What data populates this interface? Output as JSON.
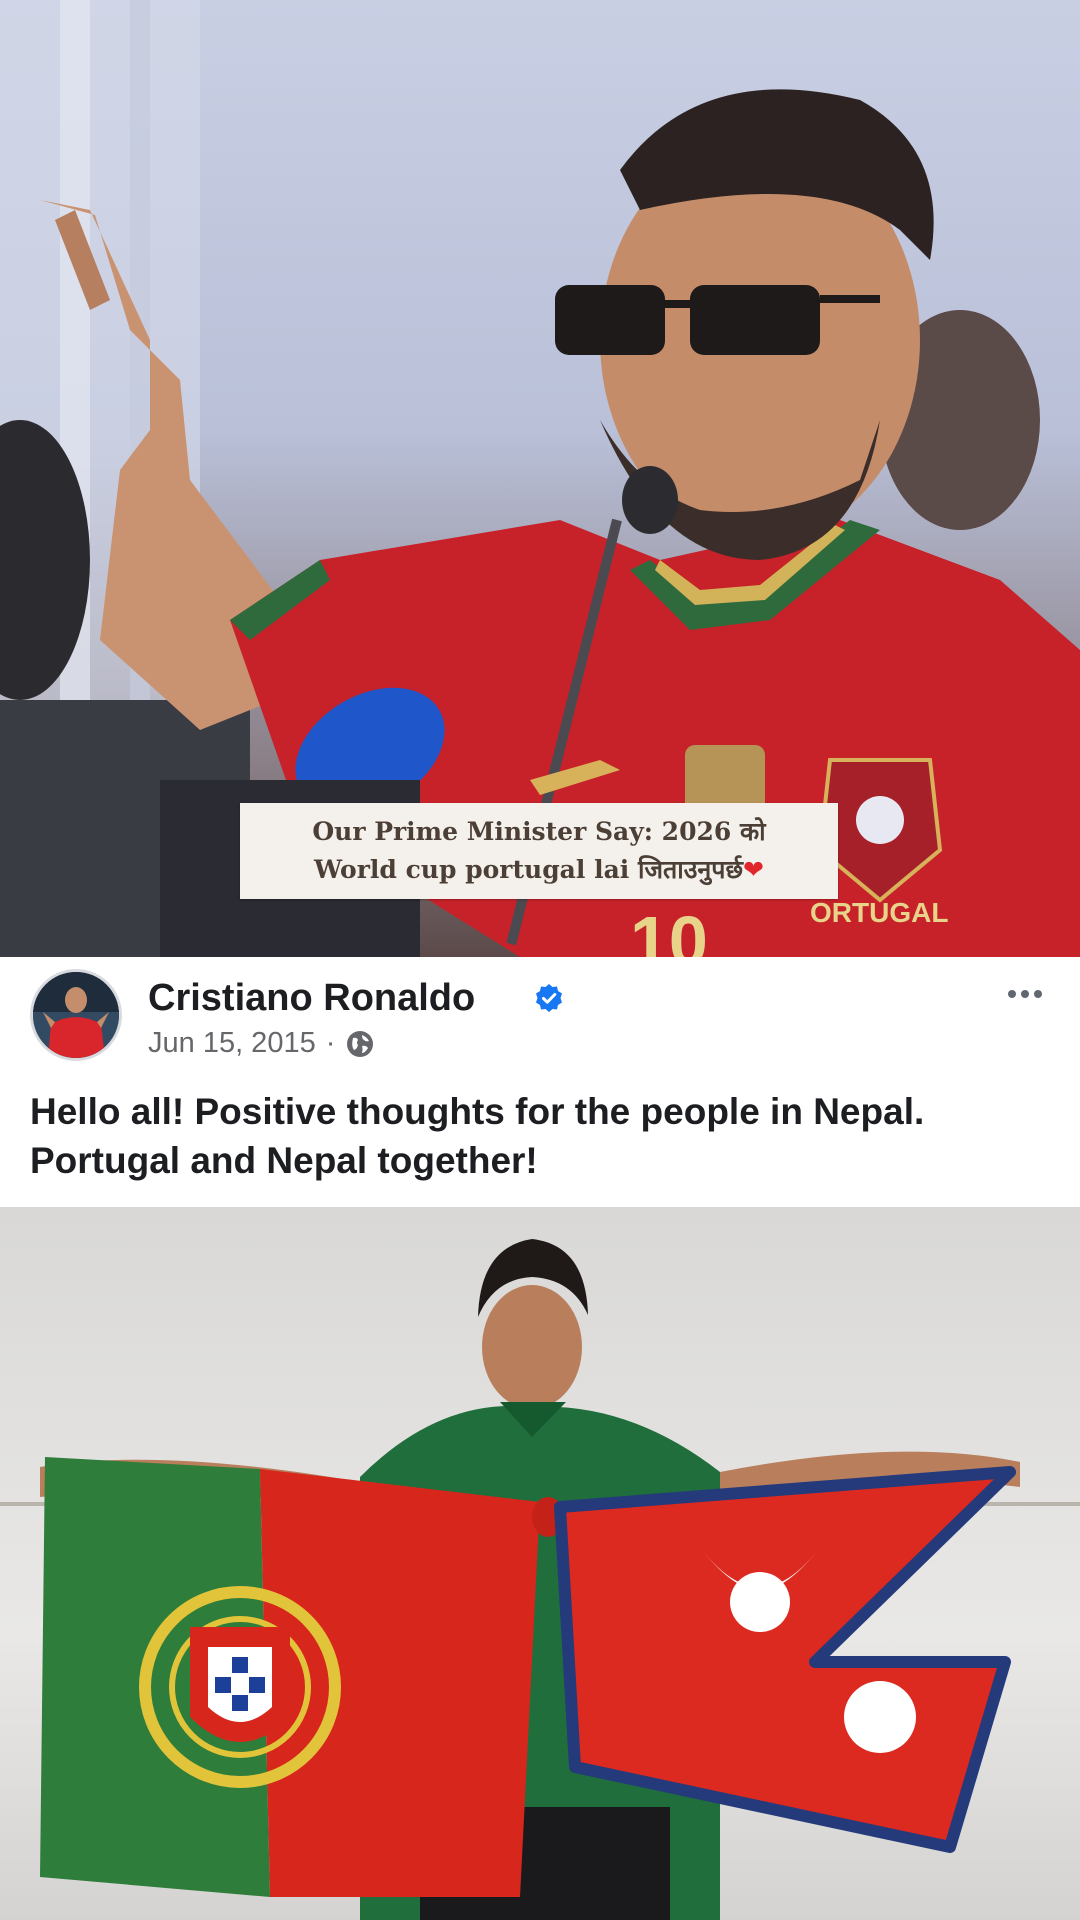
{
  "top_photo": {
    "caption_line_1": "Our Prime Minister Say: 2026 को",
    "caption_line_2": "World cup portugal lai  जिताउनुपर्छ",
    "caption_heart": "❤",
    "jersey_text": "ORTUGAL",
    "jersey_number": "10"
  },
  "post": {
    "author_name": "Cristiano Ronaldo",
    "date": "Jun 15, 2015",
    "separator": "·",
    "text_line_1": "Hello all! Positive thoughts for the people in Nepal.",
    "text_line_2": "Portugal and Nepal together!",
    "icons": {
      "verified": "verified-badge-icon",
      "audience": "globe-icon",
      "more": "more-options-icon"
    }
  },
  "colors": {
    "verified_blue": "#1877f2",
    "text_primary": "#1c1e21",
    "text_secondary": "#65676b",
    "portugal_green": "#2e7d3a",
    "portugal_red": "#d7271d",
    "nepal_crimson": "#dc2a20",
    "nepal_border": "#243a7a"
  }
}
